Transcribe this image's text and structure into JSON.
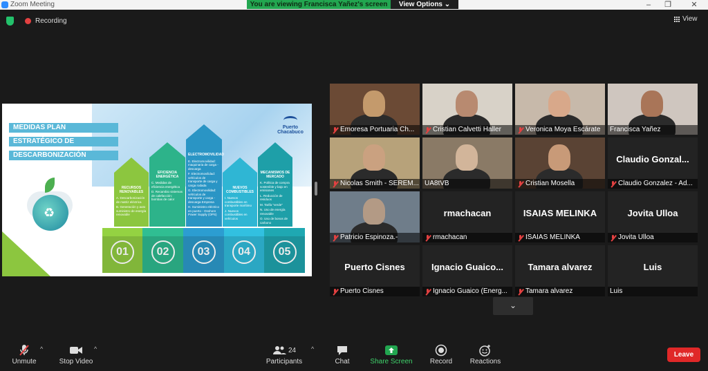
{
  "window": {
    "title": "Zoom Meeting",
    "controls": [
      "–",
      "❐",
      "✕"
    ]
  },
  "share_banner": {
    "text": "You are viewing Francisca Yañez's screen",
    "view_options": "View Options ⌄"
  },
  "recording_label": "Recording",
  "view_label": "View",
  "slide": {
    "title_lines": [
      "MEDIDAS PLAN",
      "ESTRATÉGICO DE",
      "DESCARBONIZACIÓN"
    ],
    "logo_text": "Puerto Chacabuco",
    "columns": [
      {
        "head": "RECURSOS RENOVABLES",
        "items": [
          "A. Descarbonización de matriz eléctrica",
          "B. Generación y auto suministro de energía renovable"
        ],
        "number": "01",
        "color": "#8cc63f"
      },
      {
        "head": "EFICIENCIA ENERGÉTICA",
        "items": [
          "C. Medidas de eficiencia energética",
          "D. Recambio sistemas de calefacción: bombas de calor"
        ],
        "number": "02",
        "color": "#2db38a"
      },
      {
        "head": "ELECTROMOVILIDAD",
        "items": [
          "E. Electromovilidad: maquinaria de carga - descarga",
          "F. Electromovilidad: vehículos de transporte de carga y carga rodada",
          "G. Electromovilidad: vehículos de transporte y carga - descarga Empresa",
          "H. Suministro eléctrico en puerto - Onshore Power Supply (OPS)"
        ],
        "number": "03",
        "color": "#2a95c5"
      },
      {
        "head": "NUEVOS COMBUSTIBLES",
        "items": [
          "I. Nuevos combustibles en transporte marítimo",
          "J. Nuevos combustibles en vehículos"
        ],
        "number": "04",
        "color": "#2fb6d4"
      },
      {
        "head": "MECANISMOS DE MERCADO",
        "items": [
          "K. Política de compra sostenible y bajo en emisiones",
          "L. Reducción de residuos",
          "M. Tarifa \"verde\"",
          "N. Uso de energía renovable",
          "O. Uso de bonos de carbono"
        ],
        "number": "05",
        "color": "#1e9fa8"
      }
    ]
  },
  "participants": [
    {
      "name": "Emoresa Portuaria Ch...",
      "big": "",
      "video": true,
      "muted": true
    },
    {
      "name": "Cristian Calvetti Haller",
      "big": "",
      "video": true,
      "muted": true
    },
    {
      "name": "Veronica Moya Escárate",
      "big": "",
      "video": true,
      "muted": true
    },
    {
      "name": "Francisca Yañez",
      "big": "",
      "video": true,
      "muted": false,
      "active": true
    },
    {
      "name": "Nicolas Smith - SEREM...",
      "big": "",
      "video": true,
      "muted": true
    },
    {
      "name": "UA8tVB",
      "big": "",
      "video": true,
      "muted": false
    },
    {
      "name": "Cristian Mosella",
      "big": "",
      "video": true,
      "muted": true
    },
    {
      "name": "Claudio Gonzalez - Ad...",
      "big": "Claudio Gonzal...",
      "video": false,
      "muted": true
    },
    {
      "name": "Patricio Espinoza.-",
      "big": "",
      "video": true,
      "muted": true
    },
    {
      "name": "rmachacan",
      "big": "rmachacan",
      "video": false,
      "muted": true
    },
    {
      "name": "ISAIAS MELINKA",
      "big": "ISAIAS MELINKA",
      "video": false,
      "muted": true
    },
    {
      "name": "Jovita Ulloa",
      "big": "Jovita Ulloa",
      "video": false,
      "muted": true
    },
    {
      "name": "Puerto Cisnes",
      "big": "Puerto Cisnes",
      "video": false,
      "muted": true
    },
    {
      "name": "Ignacio Guaico (Energ...",
      "big": "Ignacio  Guaico...",
      "video": false,
      "muted": true
    },
    {
      "name": "Tamara alvarez",
      "big": "Tamara alvarez",
      "video": false,
      "muted": true
    },
    {
      "name": "Luis",
      "big": "Luis",
      "video": false,
      "muted": false
    }
  ],
  "toolbar": {
    "unmute": "Unmute",
    "stop_video": "Stop Video",
    "participants": "Participants",
    "participants_count": "24",
    "chat": "Chat",
    "share_screen": "Share Screen",
    "record": "Record",
    "reactions": "Reactions",
    "leave": "Leave"
  },
  "colors": {
    "share_green": "#22a650",
    "leave_red": "#e02828",
    "active_speaker": "#c8e85a"
  }
}
